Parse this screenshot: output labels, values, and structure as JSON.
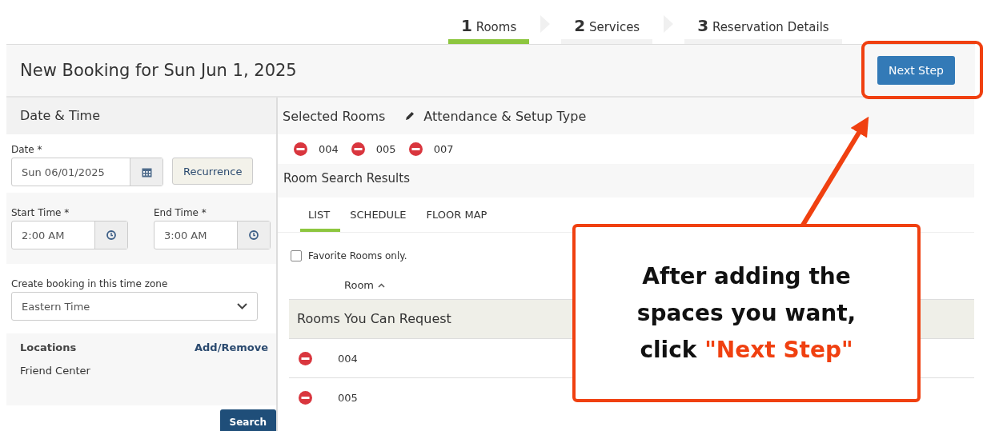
{
  "steps": [
    {
      "number": "1",
      "label": "Rooms",
      "selected": true
    },
    {
      "number": "2",
      "label": "Services",
      "selected": false
    },
    {
      "number": "3",
      "label": "Reservation Details",
      "selected": false
    }
  ],
  "header": {
    "title": "New Booking for Sun Jun 1, 2025",
    "next_button": "Next Step"
  },
  "left_panel": {
    "title": "Date & Time",
    "date": {
      "label": "Date *",
      "value": "Sun 06/01/2025"
    },
    "recurrence_button": "Recurrence",
    "start_time": {
      "label": "Start Time *",
      "value": "2:00 AM"
    },
    "end_time": {
      "label": "End Time *",
      "value": "3:00 AM"
    },
    "time_zone": {
      "label": "Create booking in this time zone",
      "value": "Eastern Time"
    },
    "locations": {
      "title": "Locations",
      "action": "Add/Remove",
      "items": [
        "Friend Center"
      ]
    },
    "search_button": "Search"
  },
  "right_panel": {
    "selected_rooms_title": "Selected Rooms",
    "attendance_link": "Attendance & Setup Type",
    "selected_rooms": [
      "004",
      "005",
      "007"
    ],
    "results_title": "Room Search Results",
    "tabs": [
      {
        "label": "LIST",
        "selected": true
      },
      {
        "label": "SCHEDULE",
        "selected": false
      },
      {
        "label": "FLOOR MAP",
        "selected": false
      }
    ],
    "favorites": {
      "label": "Favorite Rooms only.",
      "checked": false
    },
    "column": "Room",
    "group": "Rooms You Can Request",
    "rows": [
      {
        "room": "004"
      },
      {
        "room": "005"
      }
    ]
  },
  "callout": {
    "text": "After adding the spaces you want, click",
    "highlight": "\"Next Step\""
  }
}
